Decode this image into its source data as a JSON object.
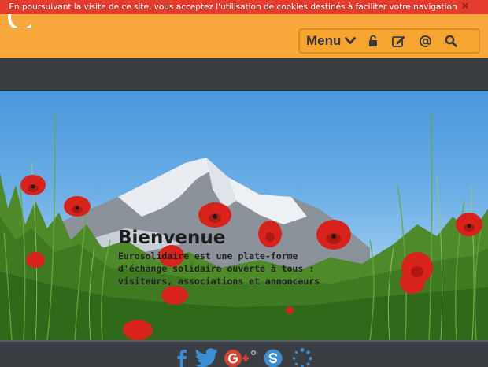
{
  "cookie_bar": {
    "message": "En poursuivant la visite de ce site, vous acceptez l'utilisation de cookies destinés à faciliter votre navigation",
    "close_label": "✕"
  },
  "toolbar": {
    "menu_label": "Menu",
    "icons": [
      "unlock-icon",
      "edit-icon",
      "at-icon",
      "search-icon"
    ]
  },
  "hero": {
    "title": "Bienvenue",
    "description": "Eurosolidaire est une plate-forme d'échange solidaire ouverte à tous : visiteurs, associations et annonceurs"
  },
  "footer": {
    "social": [
      "facebook-icon",
      "twitter-icon",
      "google-plus-icon",
      "skype-icon",
      "loading-icon"
    ]
  },
  "colors": {
    "header": "#f9a93b",
    "cookie_bar": "#e33c2e",
    "navbar": "#3a3d42",
    "social_blue": "#3b8ed3",
    "google_red": "#d64531"
  }
}
